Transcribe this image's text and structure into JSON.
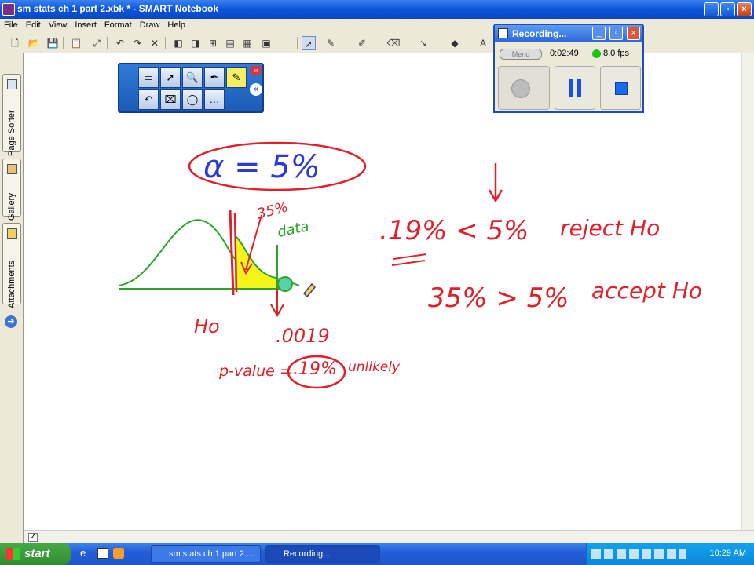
{
  "window": {
    "title": "sm stats  ch 1 part 2.xbk * - SMART Notebook"
  },
  "menu": [
    "File",
    "Edit",
    "View",
    "Insert",
    "Format",
    "Draw",
    "Help"
  ],
  "sidebar": {
    "tabs": [
      "Page Sorter",
      "Gallery",
      "Attachments"
    ]
  },
  "recorder": {
    "title": "Recording...",
    "menu_label": "Menu",
    "elapsed": "0:02:49",
    "fps": "8.0 fps"
  },
  "board": {
    "alpha_formula": "α = 5%",
    "label_35": "35%",
    "label_data": "data",
    "label_ho": "Ho",
    "label_0019": ".0019",
    "pvalue_text": "p-value =",
    "pvalue_circled": ".19%",
    "pvalue_tail": "unlikely",
    "line1_cmp": ".19% < 5%",
    "line1_result": "reject Ho",
    "line2_cmp": "35% > 5%",
    "line2_result": "accept Ho"
  },
  "taskbar": {
    "start": "start",
    "tasks": [
      "sm stats  ch 1 part 2....",
      "Recording..."
    ],
    "clock": "10:29 AM"
  },
  "colors": {
    "xp_blue": "#0c55d8",
    "ink_red": "#e0202a",
    "ink_blue": "#2c3ad6",
    "ink_green": "#2aa52a",
    "highlight_yellow": "#f4f41a"
  }
}
